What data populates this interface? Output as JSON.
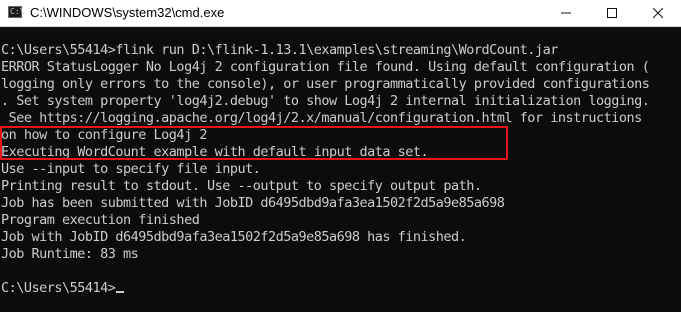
{
  "window": {
    "title": "C:\\WINDOWS\\system32\\cmd.exe",
    "icon": "cmd-icon",
    "controls": [
      "minimize-icon",
      "maximize-icon",
      "close-icon"
    ]
  },
  "console": {
    "lines": [
      "C:\\Users\\55414>flink run D:\\flink-1.13.1\\examples\\streaming\\WordCount.jar",
      "ERROR StatusLogger No Log4j 2 configuration file found. Using default configuration (",
      "logging only errors to the console), or user programmatically provided configurations",
      ". Set system property 'log4j2.debug' to show Log4j 2 internal initialization logging.",
      " See https://logging.apache.org/log4j/2.x/manual/configuration.html for instructions",
      "on how to configure Log4j 2",
      "Executing WordCount example with default input data set.",
      "Use --input to specify file input.",
      "Printing result to stdout. Use --output to specify output path.",
      "Job has been submitted with JobID d6495dbd9afa3ea1502f2d5a9e85a698",
      "Program execution finished",
      "Job with JobID d6495dbd9afa3ea1502f2d5a9e85a698 has finished.",
      "Job Runtime: 83 ms"
    ],
    "prompt": "C:\\Users\\55414>"
  },
  "colors": {
    "console_bg": "#0c0c0c",
    "console_text": "#cccccc",
    "highlight_border": "#e8141b"
  }
}
